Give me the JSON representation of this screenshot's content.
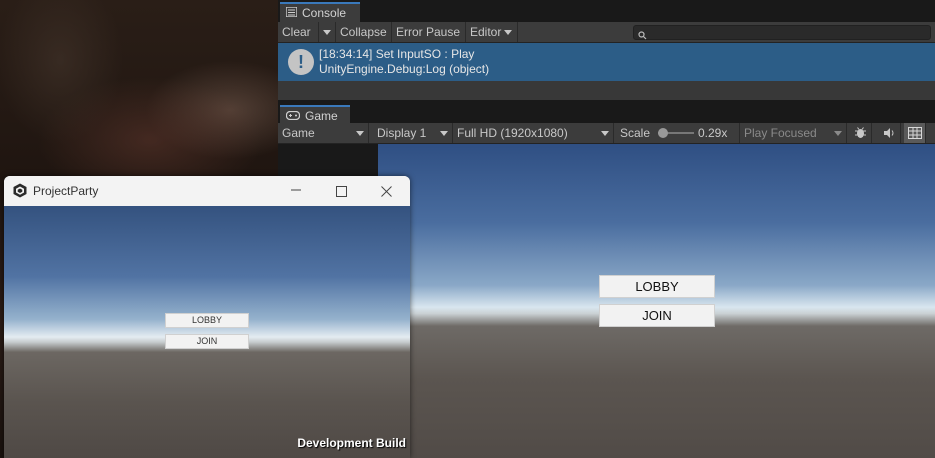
{
  "console": {
    "tab_title": "Console",
    "toolbar": {
      "clear": "Clear",
      "collapse": "Collapse",
      "error_pause": "Error Pause",
      "editor": "Editor"
    },
    "log_entry": {
      "time_message": "[18:34:14] Set InputSO : Play",
      "source": "UnityEngine.Debug:Log (object)"
    }
  },
  "game": {
    "tab_title": "Game",
    "toolbar": {
      "view_mode": "Game",
      "display": "Display 1",
      "resolution": "Full HD (1920x1080)",
      "scale_label": "Scale",
      "scale_value": "0.29x",
      "play_mode": "Play Focused"
    },
    "buttons": {
      "lobby": "LOBBY",
      "join": "JOIN"
    }
  },
  "player_window": {
    "title": "ProjectParty",
    "buttons": {
      "lobby": "LOBBY",
      "join": "JOIN"
    },
    "watermark": "Development Build"
  },
  "icons": [
    "console-tab-icon",
    "dropdown-arrow-icon",
    "search-icon",
    "info-icon",
    "gamepad-icon",
    "bug-icon",
    "audio-icon",
    "stats-icon",
    "unity-logo-icon",
    "minimize-icon",
    "maximize-icon",
    "close-icon"
  ]
}
